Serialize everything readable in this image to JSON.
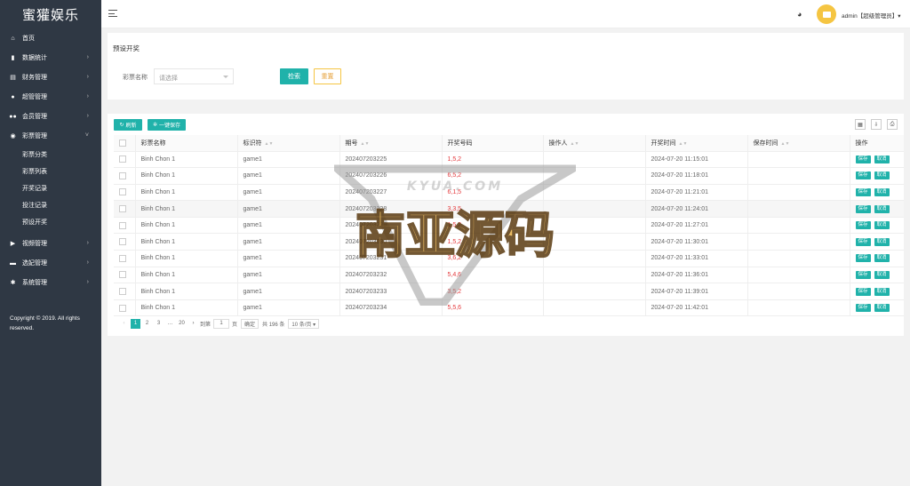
{
  "app": {
    "logo": "蜜獾娱乐"
  },
  "sidebar": {
    "items": [
      {
        "label": "首页",
        "icon": "home-icon",
        "arrow": false
      },
      {
        "label": "数据统计",
        "icon": "bar-chart-icon",
        "arrow": true
      },
      {
        "label": "财务管理",
        "icon": "finance-icon",
        "arrow": true
      },
      {
        "label": "超管管理",
        "icon": "user-icon",
        "arrow": true
      },
      {
        "label": "会员管理",
        "icon": "users-icon",
        "arrow": true
      },
      {
        "label": "彩票管理",
        "icon": "gamepad-icon",
        "arrow": true
      }
    ],
    "subitems": [
      "彩票分类",
      "彩票列表",
      "开奖记录",
      "投注记录",
      "预设开奖"
    ],
    "items_after": [
      {
        "label": "视频管理",
        "icon": "video-icon"
      },
      {
        "label": "选妃管理",
        "icon": "folder-icon"
      },
      {
        "label": "系统管理",
        "icon": "gear-icon"
      }
    ],
    "copyright": "Copyright © 2019. All rights reserved."
  },
  "header": {
    "user": "admin【超级管理员】▾"
  },
  "filter": {
    "title": "预设开奖",
    "label": "彩票名称",
    "placeholder": "请选择",
    "search_label": "检索",
    "reset_label": "重置"
  },
  "toolbar": {
    "refresh_label": "刷新",
    "save_all_label": "一键保存"
  },
  "table": {
    "headers": [
      "彩票名称",
      "标识符",
      "期号",
      "开奖号码",
      "操作人",
      "开奖时间",
      "保存时间",
      "操作"
    ],
    "rows": [
      [
        "Binh Chon 1",
        "game1",
        "202407203225",
        "1,5,2",
        "",
        "2024-07-20 11:15:01",
        ""
      ],
      [
        "Binh Chon 1",
        "game1",
        "202407203226",
        "6,5,2",
        "",
        "2024-07-20 11:18:01",
        ""
      ],
      [
        "Binh Chon 1",
        "game1",
        "202407203227",
        "6,1,5",
        "",
        "2024-07-20 11:21:01",
        ""
      ],
      [
        "Binh Chon 1",
        "game1",
        "202407203228",
        "3,3,5",
        "",
        "2024-07-20 11:24:01",
        ""
      ],
      [
        "Binh Chon 1",
        "game1",
        "202407203229",
        "1,5,2",
        "",
        "2024-07-20 11:27:01",
        ""
      ],
      [
        "Binh Chon 1",
        "game1",
        "202407203230",
        "1,5,2",
        "",
        "2024-07-20 11:30:01",
        ""
      ],
      [
        "Binh Chon 1",
        "game1",
        "202407203231",
        "3,6,2",
        "",
        "2024-07-20 11:33:01",
        ""
      ],
      [
        "Binh Chon 1",
        "game1",
        "202407203232",
        "5,4,6",
        "",
        "2024-07-20 11:36:01",
        ""
      ],
      [
        "Binh Chon 1",
        "game1",
        "202407203233",
        "3,5,2",
        "",
        "2024-07-20 11:39:01",
        ""
      ],
      [
        "Binh Chon 1",
        "game1",
        "202407203234",
        "5,5,6",
        "",
        "2024-07-20 11:42:01",
        ""
      ]
    ],
    "save_label": "保存",
    "cancel_label": "取消"
  },
  "pager": {
    "prev": "‹",
    "p1": "1",
    "p2": "2",
    "p3": "3",
    "ellipsis": "…",
    "last": "20",
    "next": "›",
    "goto_label": "到第",
    "goto_value": "1",
    "page_unit": "页",
    "confirm": "确定",
    "total": "共 196 条",
    "per_page": "10 条/页 ▾"
  },
  "watermark": {
    "text": "南亚源码",
    "subtext": "KYUA.COM"
  },
  "colors": {
    "sidebar": "#2f3844",
    "accent": "#20b2aa",
    "red": "#e4393c",
    "warn": "#f5c542"
  }
}
